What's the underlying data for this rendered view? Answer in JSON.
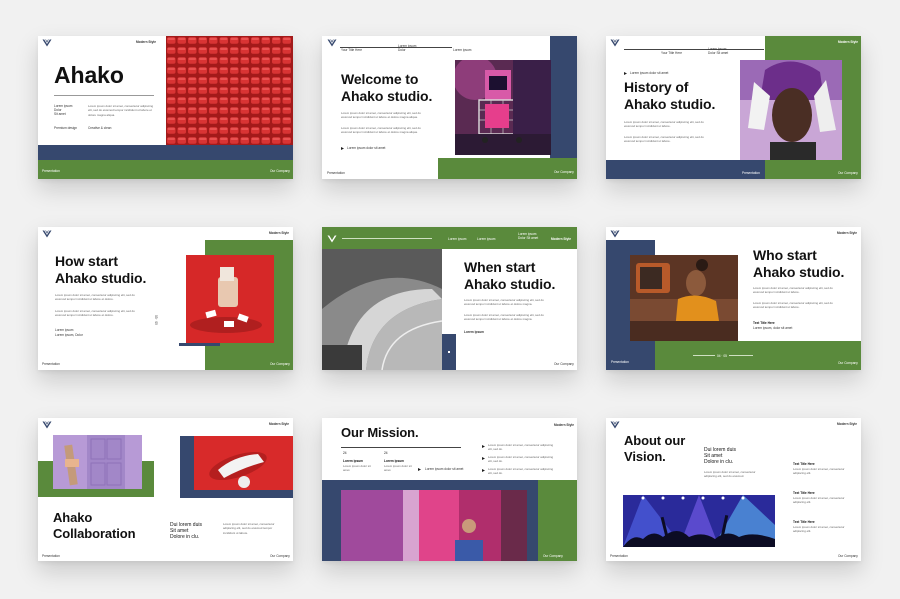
{
  "brand": {
    "corner_label": "Modern Style"
  },
  "colors": {
    "green": "#5a8a3c",
    "navy": "#36486e",
    "red": "#d32b2b",
    "page_bg": "#f1f1f1"
  },
  "slides": {
    "s1": {
      "title": "Ahako",
      "contact1": "Lorem ipsum",
      "contact2": "Dolor",
      "contact3": "Sit amet",
      "desc": "Lorem ipsum dolor sit amet, consectetur adipiscing elit, sed do eiusmod tempor incididunt ut labore et dolore magna aliqua.",
      "label_left": "Premium design",
      "label_right": "Creative & clean",
      "foot_left": "Presentation",
      "foot_right": "Our Company"
    },
    "s2": {
      "nav1": "Your Title Here",
      "nav2": "Lorem ipsum Dolor",
      "nav3": "Lorem ipsum",
      "title_line1": "Welcome to",
      "title_line2": "Ahako studio.",
      "p1": "Lorem ipsum dolor sit amet, consectetur adipiscing elit, sed do eiusmod tempor incididunt ut labore et dolore magna aliqua.",
      "p2": "Lorem ipsum dolor sit amet, consectetur adipiscing elit, sed do eiusmod tempor incididunt ut labore et dolore magna aliqua.",
      "link": "Lorem ipsum dolor sit amet",
      "foot_left": "Presentation",
      "foot_right": "Our Company"
    },
    "s3": {
      "nav1": "Your Title Here",
      "nav2": "Lorem ipsum Dolor Sit amet",
      "bullet_label": "Lorem ipsum dolor sit amet",
      "title_line1": "History of",
      "title_line2": "Ahako studio.",
      "p1": "Lorem ipsum dolor sit amet, consectetur adipiscing elit, sed do eiusmod tempor incididunt ut labore.",
      "p2": "Lorem ipsum dolor sit amet, consectetur adipiscing elit, sed do eiusmod tempor incididunt ut labore.",
      "foot_left": "Presentation",
      "foot_right": "Our Company"
    },
    "s4": {
      "title_line1": "How start",
      "title_line2": "Ahako studio.",
      "p1": "Lorem ipsum dolor sit amet, consectetur adipiscing elit, sed do eiusmod tempor incididunt ut labore et dolore.",
      "p2": "Lorem ipsum dolor sit amet, consectetur adipiscing elit, sed do eiusmod tempor incididunt ut labore et dolore.",
      "vert_number": "03 · 05",
      "sig1": "Lorem ipsum",
      "sig2": "Lorem ipsum, Dolor",
      "foot_left": "Presentation",
      "foot_right": "Our Company"
    },
    "s5": {
      "nav1": "Lorem ipsum",
      "nav2": "Lorem ipsum",
      "nav3": "Lorem ipsum Dolor Sit amet",
      "title_line1": "When start",
      "title_line2": "Ahako studio.",
      "p1": "Lorem ipsum dolor sit amet, consectetur adipiscing elit, sed do eiusmod tempor incididunt ut labore et dolore magna.",
      "p2": "Lorem ipsum dolor sit amet, consectetur adipiscing elit, sed do eiusmod tempor incididunt ut labore et dolore magna.",
      "link": "Lorem ipsum",
      "foot_right": "Our Company"
    },
    "s6": {
      "title_line1": "Who start",
      "title_line2": "Ahako studio.",
      "p1": "Lorem ipsum dolor sit amet, consectetur adipiscing elit, sed do eiusmod tempor incididunt ut labore.",
      "p2": "Lorem ipsum dolor sit amet, consectetur adipiscing elit, sed do eiusmod tempor incididunt ut labore.",
      "sub_title": "Text Title Here",
      "sub_desc": "Lorem ipsum, dolor sit amet",
      "page_num": "04 · 05",
      "foot_left": "Presentation",
      "foot_right": "Our Company"
    },
    "s7": {
      "title_line1": "Ahako",
      "title_line2": "Collaboration",
      "right_line1": "Dui lorem duis",
      "right_line2": "Sit amet",
      "right_line3": "Dolore in clu.",
      "right_desc": "Lorem ipsum dolor sit amet, consectetur adipiscing elit, sed do eiusmod tempor incididunt ut labore.",
      "foot_left": "Presentation",
      "foot_right": "Our Company"
    },
    "s8": {
      "title": "Our Mission.",
      "n1": "24",
      "l1": "Lorem ipsum",
      "d1": "Lorem ipsum dolor sit amet.",
      "n2": "24",
      "l2": "Lorem ipsum",
      "d2": "Lorem ipsum dolor sit amet.",
      "link": "Lorem ipsum dolor sit amet",
      "r1": "Lorem ipsum dolor sit amet, consectetur adipiscing elit, sed do.",
      "r2": "Lorem ipsum dolor sit amet, consectetur adipiscing elit, sed do.",
      "r3": "Lorem ipsum dolor sit amet, consectetur adipiscing elit, sed do.",
      "r4": "Lorem ipsum dolor sit amet, consectetur adipiscing elit, sed do.",
      "foot_right": "Our Company"
    },
    "s9": {
      "title_line1": "About our",
      "title_line2": "Vision.",
      "mid_line1": "Dui lorem duis",
      "mid_line2": "Sit amet",
      "mid_line3": "Dolore in clu.",
      "mid_desc": "Lorem ipsum dolor sit amet, consectetur adipiscing elit, sed do eiusmod.",
      "item1_title": "Text Title Here",
      "item1_desc": "Lorem ipsum dolor sit amet, consectetur adipiscing elit.",
      "item2_title": "Text Title Here",
      "item2_desc": "Lorem ipsum dolor sit amet, consectetur adipiscing elit.",
      "item3_title": "Text Title Here",
      "item3_desc": "Lorem ipsum dolor sit amet, consectetur adipiscing elit.",
      "foot_left": "Presentation",
      "foot_right": "Our Company"
    }
  }
}
